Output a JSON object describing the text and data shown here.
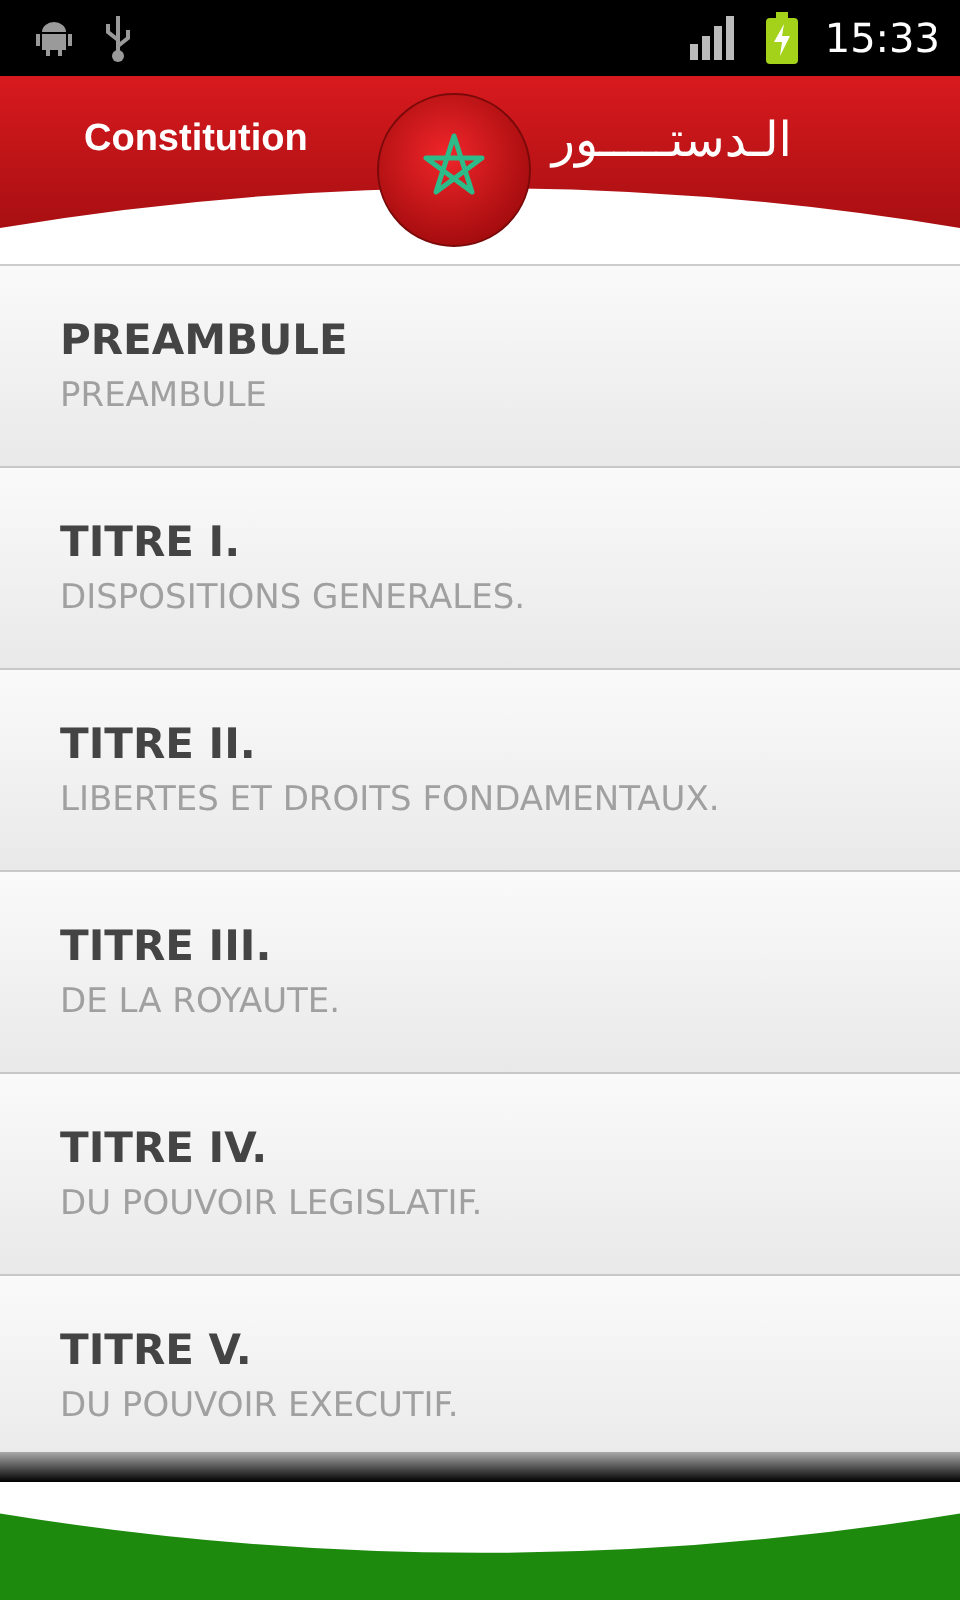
{
  "status_bar": {
    "time": "15:33"
  },
  "header": {
    "title": "Constitution",
    "title_arabic": "الـدستـــــور"
  },
  "items": [
    {
      "title": "PREAMBULE",
      "subtitle": "PREAMBULE"
    },
    {
      "title": "TITRE I.",
      "subtitle": "DISPOSITIONS GENERALES."
    },
    {
      "title": "TITRE II.",
      "subtitle": "LIBERTES ET DROITS FONDAMENTAUX."
    },
    {
      "title": "TITRE III.",
      "subtitle": "DE LA ROYAUTE."
    },
    {
      "title": "TITRE IV.",
      "subtitle": "DU POUVOIR LEGISLATIF."
    },
    {
      "title": "TITRE V.",
      "subtitle": "DU POUVOIR EXECUTIF."
    }
  ]
}
